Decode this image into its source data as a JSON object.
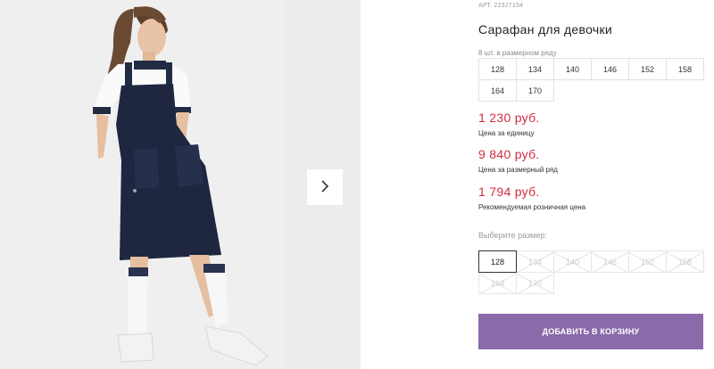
{
  "product": {
    "article": "АРТ. 22327154",
    "title": "Сарафан для девочки",
    "size_row_caption": "8 шт. в размерном ряду",
    "size_row": [
      "128",
      "134",
      "140",
      "146",
      "152",
      "158",
      "164",
      "170"
    ]
  },
  "prices": [
    {
      "amount": "1 230 руб.",
      "caption": "Цена за единицу"
    },
    {
      "amount": "9 840 руб.",
      "caption": "Цена за размерный ряд"
    },
    {
      "amount": "1 794 руб.",
      "caption": "Рекомендуемая розничная цена"
    }
  ],
  "size_picker": {
    "caption": "Выберите размер:",
    "selected": "128",
    "sizes": [
      "128",
      "134",
      "140",
      "146",
      "152",
      "158",
      "164",
      "170"
    ]
  },
  "cart_button_label": "ДОБАВИТЬ В КОРЗИНУ",
  "gallery": {
    "next_icon": "chevron-right-icon"
  },
  "colors": {
    "price": "#d42b3f",
    "button": "#8a6aa8",
    "dress": "#1e2640"
  }
}
